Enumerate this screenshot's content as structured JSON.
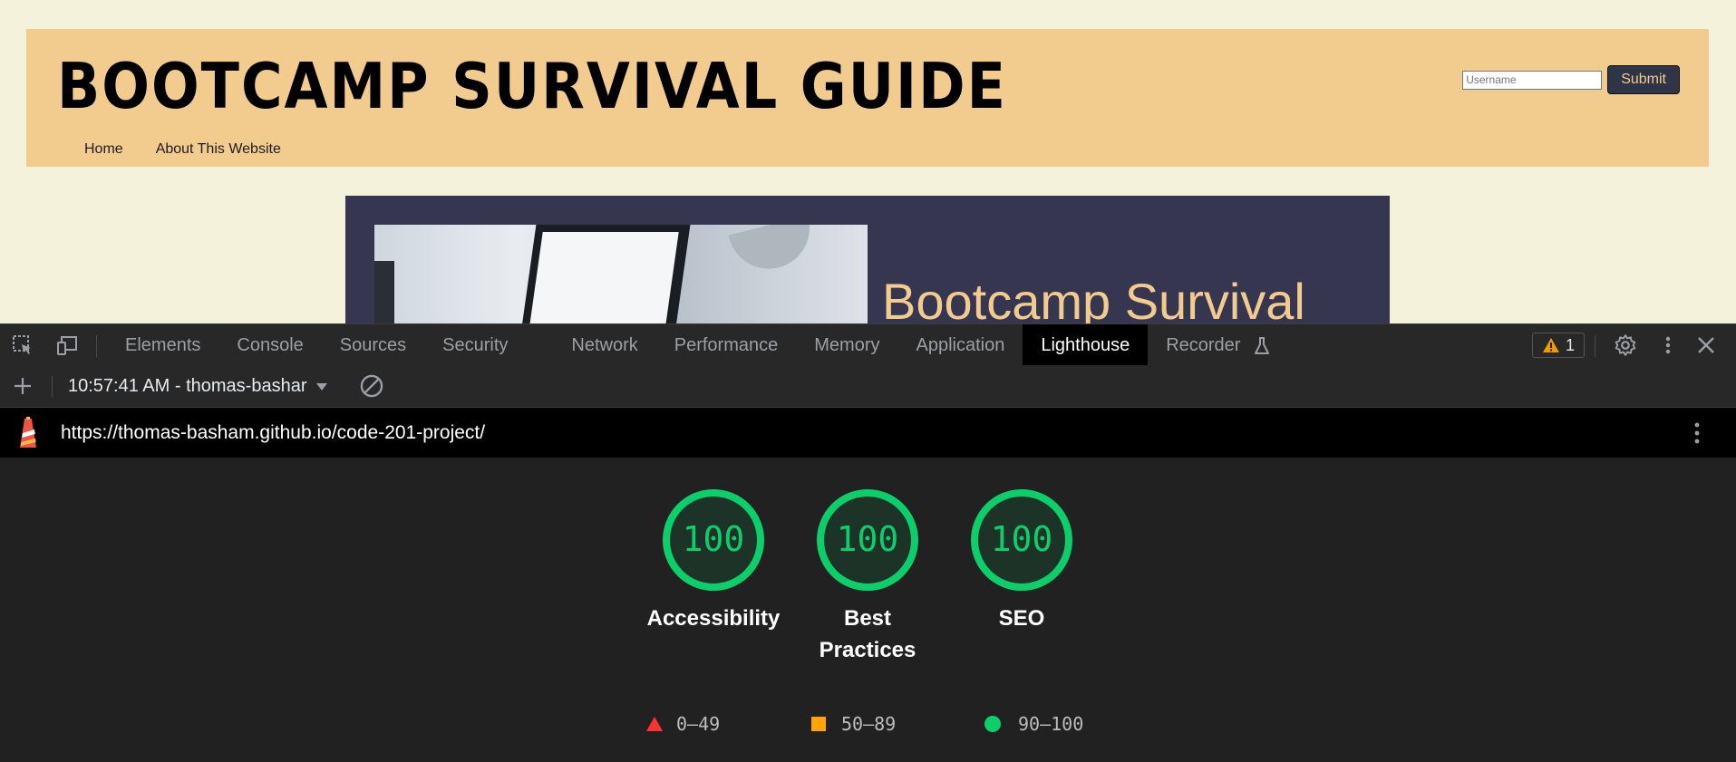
{
  "site": {
    "title": "Bootcamp Survival Guide",
    "nav": [
      "Home",
      "About This Website"
    ],
    "username_placeholder": "Username",
    "submit_label": "Submit",
    "hero_title": "Bootcamp Survival"
  },
  "devtools": {
    "tabs": [
      "Elements",
      "Console",
      "Sources",
      "Security",
      "Network",
      "Performance",
      "Memory",
      "Application",
      "Lighthouse",
      "Recorder"
    ],
    "active_tab": "Lighthouse",
    "warning_count": "1",
    "report_selector": "10:57:41 AM - thomas-bashar",
    "url": "https://thomas-basham.github.io/code-201-project/",
    "scores": [
      {
        "label": "Accessibility",
        "value": 100
      },
      {
        "label": "Best Practices",
        "value": 100
      },
      {
        "label": "SEO",
        "value": 100
      }
    ],
    "legend": [
      {
        "range": "0–49",
        "shape": "triangle",
        "color": "#ff3333"
      },
      {
        "range": "50–89",
        "shape": "square",
        "color": "#ffa400"
      },
      {
        "range": "90–100",
        "shape": "circle",
        "color": "#0cce6b"
      }
    ]
  },
  "colors": {
    "header_bg": "#f2cb8f",
    "hero_bg": "#373650",
    "score_green": "#0cce6b"
  }
}
